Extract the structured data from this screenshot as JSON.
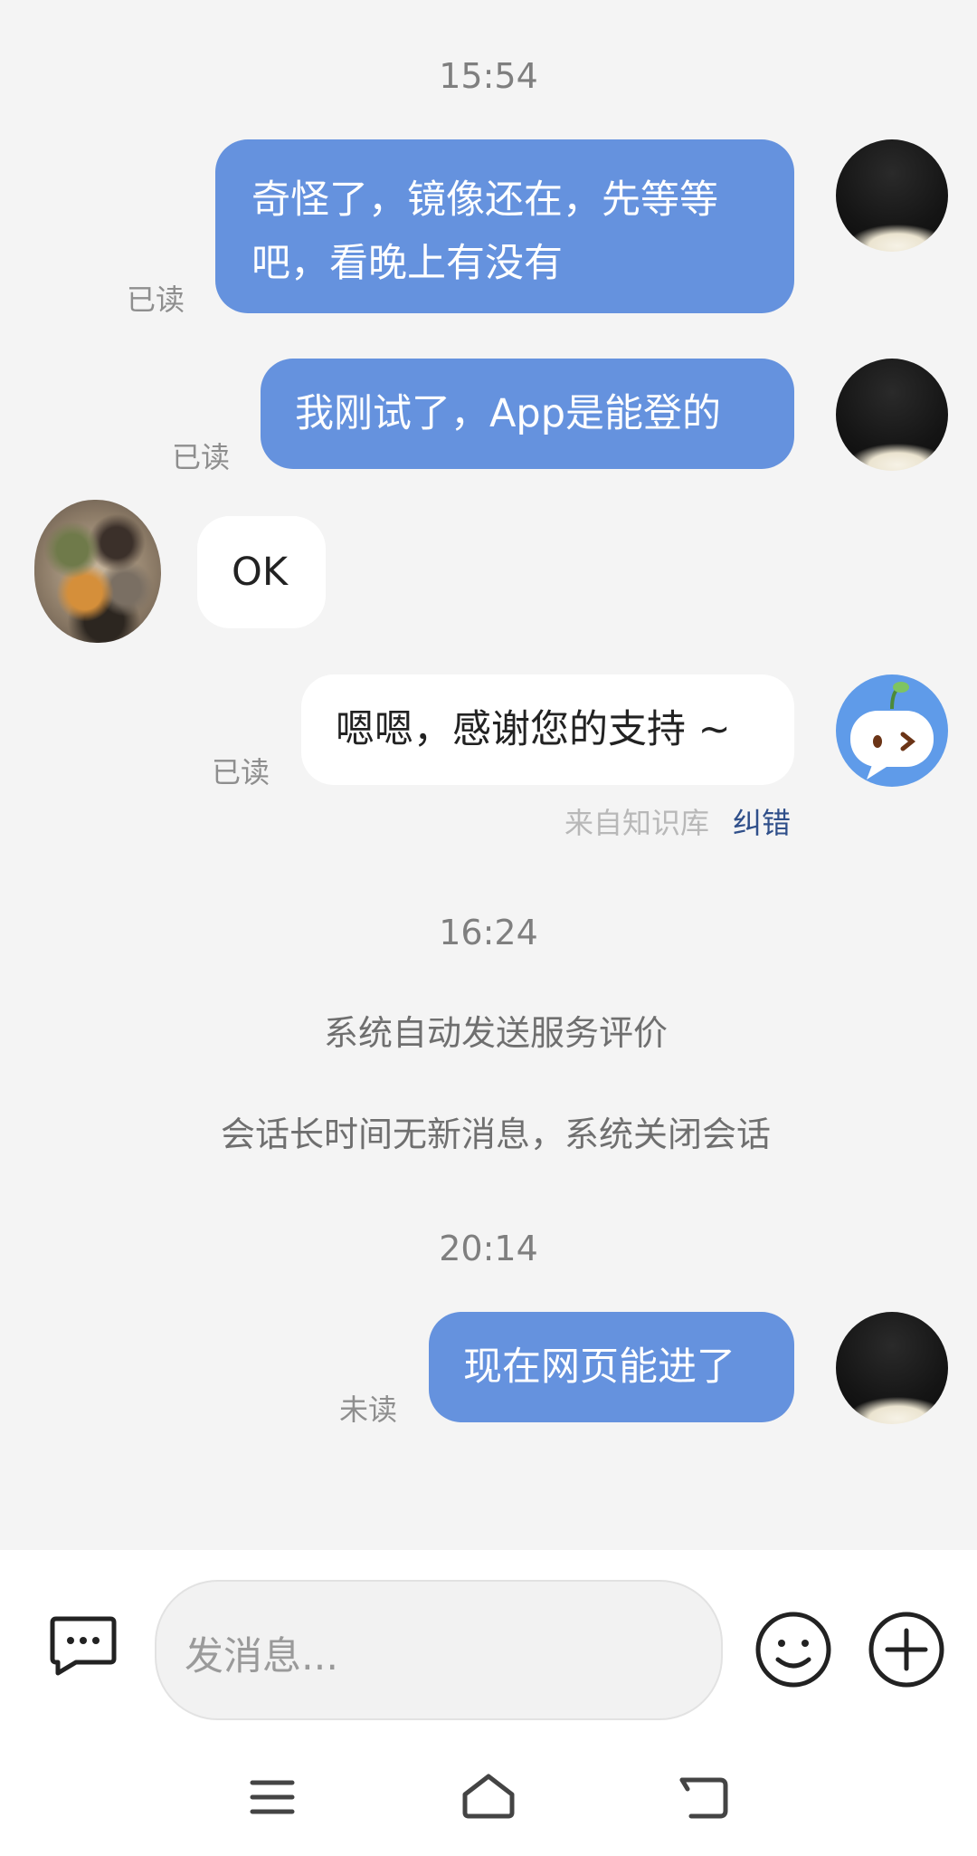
{
  "messages": {
    "time1": "15:54",
    "m1": {
      "line1": "奇怪了，镜像还在，先等等",
      "line2": "吧，看晚上有没有",
      "status": "已读"
    },
    "m2": {
      "text": "我刚试了，App是能登的",
      "status": "已读"
    },
    "m3": {
      "text": "OK"
    },
    "m4": {
      "text": "嗯嗯，感谢您的支持 ~",
      "status": "已读",
      "source": "来自知识库",
      "correct": "纠错"
    },
    "time2": "16:24",
    "sys1": "系统自动发送服务评价",
    "sys2": "会话长时间无新消息，系统关闭会话",
    "time3": "20:14",
    "m5": {
      "text": "现在网页能进了",
      "status": "未读"
    }
  },
  "input": {
    "placeholder": "发消息..."
  },
  "icons": {
    "chat": "quick-reply-icon",
    "emoji": "emoji-icon",
    "plus": "plus-icon",
    "menu": "menu-icon",
    "home": "home-icon",
    "back": "back-icon"
  },
  "colors": {
    "bubble_blue": "#6592de",
    "link": "#2f4f8a"
  }
}
